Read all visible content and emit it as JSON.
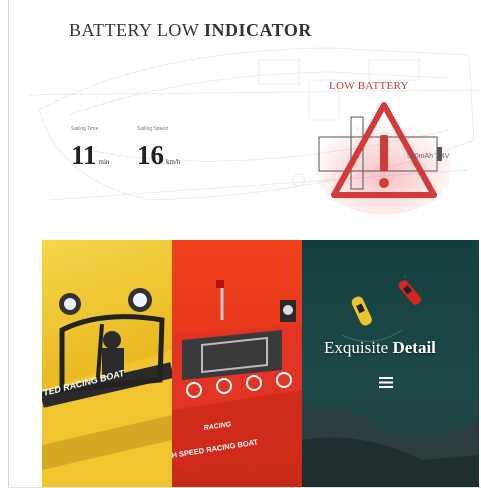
{
  "title": {
    "light": "BATTERY LOW",
    "bold": "INDICATOR"
  },
  "stats": [
    {
      "label": "Sailing Time",
      "value": "11",
      "unit": "min"
    },
    {
      "label": "Sailing Speed",
      "value": "16",
      "unit": "km/h"
    }
  ],
  "warning": {
    "label": "LOW BATTERY",
    "battery_text": "500mAh 7.4V"
  },
  "panels": [
    {
      "name": "yellow-boat-closeup",
      "hull_text": "TED RACING BOAT"
    },
    {
      "name": "red-boat-closeup",
      "hull_text": "H SPEED RACING BOAT",
      "deck_text": "RACING"
    },
    {
      "name": "aerial-water",
      "heading_light": "Exquisite",
      "heading_bold": "Detail"
    }
  ],
  "colors": {
    "warning_red": "#d23b3b",
    "yellow_panel": "#f0c834",
    "red_panel": "#e8381b",
    "teal_panel": "#1a4443"
  },
  "icons": [
    "warning-triangle-icon",
    "battery-icon",
    "menu-icon"
  ]
}
